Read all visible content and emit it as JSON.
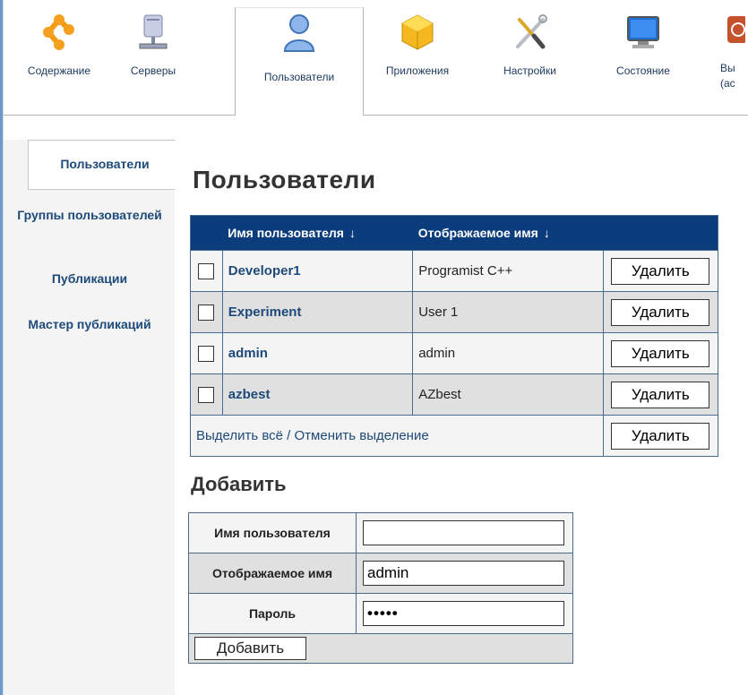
{
  "toolbar": {
    "items": [
      {
        "label": "Содержание",
        "icon": "content-icon"
      },
      {
        "label": "Серверы",
        "icon": "server-icon"
      },
      {
        "label": "Пользователи",
        "icon": "user-icon"
      },
      {
        "label": "Приложения",
        "icon": "package-icon"
      },
      {
        "label": "Настройки",
        "icon": "tools-icon"
      },
      {
        "label": "Состояние",
        "icon": "monitor-icon"
      },
      {
        "label": "Вы",
        "label2": "(ac",
        "icon": "exit-icon"
      }
    ],
    "active": "Пользователи"
  },
  "sidebar": {
    "items": [
      {
        "label": "Пользователи"
      },
      {
        "label": "Группы пользователей"
      },
      {
        "label": "Публикации"
      },
      {
        "label": "Мастер публикаций"
      }
    ]
  },
  "page": {
    "title": "Пользователи",
    "table": {
      "headers": [
        "Имя пользователя",
        "Отображаемое имя"
      ],
      "sort_arrow": "↓",
      "rows": [
        {
          "username": "Developer1",
          "display_name": "Programist C++",
          "action": "Удалить"
        },
        {
          "username": "Experiment",
          "display_name": "User 1",
          "action": "Удалить"
        },
        {
          "username": "admin",
          "display_name": "admin",
          "action": "Удалить"
        },
        {
          "username": "azbest",
          "display_name": "AZbest",
          "action": "Удалить"
        }
      ],
      "select_all": "Выделить всё / Отменить выделение",
      "bulk_delete": "Удалить"
    },
    "add": {
      "title": "Добавить",
      "fields": [
        {
          "label": "Имя пользователя",
          "value": ""
        },
        {
          "label": "Отображаемое имя",
          "value": "admin"
        },
        {
          "label": "Пароль",
          "value": "•••••"
        }
      ],
      "submit": "Добавить"
    }
  },
  "colors": {
    "header_bg": "#0b3c7c",
    "link": "#1d4a7a",
    "accent_stripe": "#6e99c8"
  }
}
